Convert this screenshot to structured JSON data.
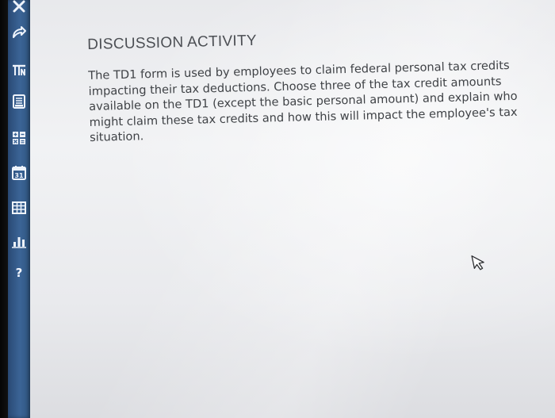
{
  "sidebar": {
    "icons": [
      {
        "name": "close-icon"
      },
      {
        "name": "share-icon"
      },
      {
        "name": "text-icon"
      },
      {
        "name": "document-icon"
      },
      {
        "name": "calculator-icon"
      },
      {
        "name": "calendar-icon",
        "label": "31"
      },
      {
        "name": "table-icon"
      },
      {
        "name": "chart-icon"
      },
      {
        "name": "help-icon",
        "label": "?"
      }
    ],
    "background": "#3b6496"
  },
  "main": {
    "heading": "DISCUSSION ACTIVITY",
    "body": "The TD1 form is used by employees to claim federal personal tax credits impacting their tax deductions. Choose three of the tax credit amounts available on the TD1 (except the basic personal amount) and explain who might claim these tax credits and how this will impact the employee's tax situation."
  },
  "colors": {
    "text": "#3f4246",
    "heading": "#4c4f54",
    "screen": "#eeeff1"
  }
}
